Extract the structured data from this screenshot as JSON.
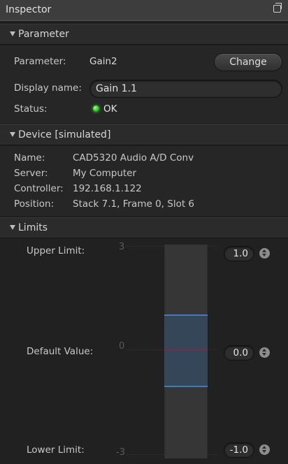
{
  "window": {
    "title": "Inspector",
    "undock_icon": "undock-icon"
  },
  "parameter": {
    "header": "Parameter",
    "param_label": "Parameter:",
    "param_value": "Gain2",
    "change_label": "Change",
    "display_label": "Display name:",
    "display_value": "Gain 1.1",
    "status_label": "Status:",
    "status_value": "OK",
    "status_color": "#2fd82a"
  },
  "device": {
    "header": "Device [simulated]",
    "rows": [
      {
        "label": "Name:",
        "value": "CAD5320 Audio A/D Conv"
      },
      {
        "label": "Server:",
        "value": "My Computer"
      },
      {
        "label": "Controller:",
        "value": "192.168.1.122"
      },
      {
        "label": "Position:",
        "value": "Stack 7.1, Frame 0, Slot 6"
      }
    ]
  },
  "limits": {
    "header": "Limits",
    "upper_label": "Upper Limit:",
    "default_label": "Default Value:",
    "lower_label": "Lower Limit:",
    "upper_value": "1.0",
    "default_value": "0.0",
    "lower_value": "-1.0",
    "axis_max": "3",
    "axis_mid": "0",
    "axis_min": "-3",
    "colors": {
      "band": "#364659",
      "limit_line": "#4a78b6",
      "default_line": "#7a2a48"
    }
  }
}
